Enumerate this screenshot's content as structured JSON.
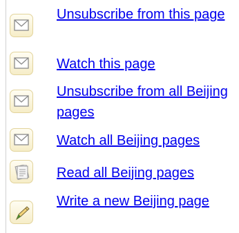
{
  "actions": [
    {
      "label": "Unsubscribe from this page",
      "icon": "envelope-icon"
    },
    {
      "label": "Watch this page",
      "icon": "envelope-icon"
    },
    {
      "label": "Unsubscribe from all Beijing pages",
      "icon": "envelope-icon"
    },
    {
      "label": "Watch all Beijing pages",
      "icon": "envelope-icon"
    },
    {
      "label": "Read all Beijing pages",
      "icon": "document-icon"
    },
    {
      "label": "Write a new Beijing page",
      "icon": "pencil-icon"
    }
  ],
  "colors": {
    "link": "#0000ee",
    "icon_border": "#e2d39a",
    "icon_fill": "#f6edc8"
  }
}
